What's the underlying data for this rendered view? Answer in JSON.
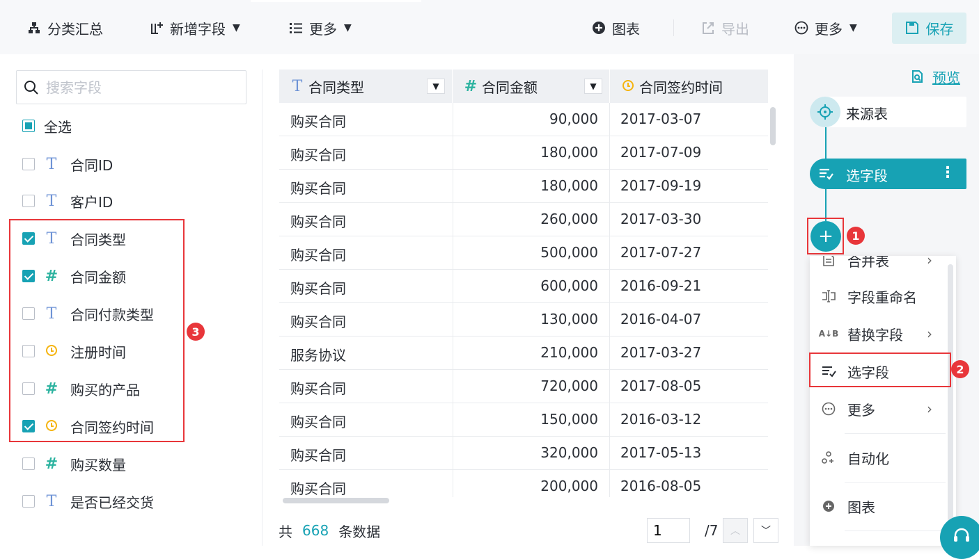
{
  "toolbar": {
    "group_summary": "分类汇总",
    "add_field": "新增字段",
    "more_left": "更多",
    "chart": "图表",
    "export": "导出",
    "more_right": "更多",
    "save": "保存"
  },
  "fields": {
    "search_placeholder": "搜索字段",
    "select_all": "全选",
    "items": [
      {
        "label": "合同ID",
        "type": "text",
        "checked": false
      },
      {
        "label": "客户ID",
        "type": "text",
        "checked": false
      },
      {
        "label": "合同类型",
        "type": "text",
        "checked": true
      },
      {
        "label": "合同金额",
        "type": "number",
        "checked": true
      },
      {
        "label": "合同付款类型",
        "type": "text",
        "checked": false
      },
      {
        "label": "注册时间",
        "type": "date",
        "checked": false
      },
      {
        "label": "购买的产品",
        "type": "number",
        "checked": false
      },
      {
        "label": "合同签约时间",
        "type": "date",
        "checked": true
      },
      {
        "label": "购买数量",
        "type": "number",
        "checked": false
      },
      {
        "label": "是否已经交货",
        "type": "text",
        "checked": false
      }
    ]
  },
  "table": {
    "columns": [
      {
        "label": "合同类型",
        "type": "text"
      },
      {
        "label": "合同金额",
        "type": "number"
      },
      {
        "label": "合同签约时间",
        "type": "date"
      }
    ],
    "rows": [
      [
        "购买合同",
        "90,000",
        "2017-03-07"
      ],
      [
        "购买合同",
        "180,000",
        "2017-07-09"
      ],
      [
        "购买合同",
        "180,000",
        "2017-09-19"
      ],
      [
        "购买合同",
        "260,000",
        "2017-03-30"
      ],
      [
        "购买合同",
        "500,000",
        "2017-07-27"
      ],
      [
        "购买合同",
        "600,000",
        "2016-09-21"
      ],
      [
        "购买合同",
        "130,000",
        "2016-04-07"
      ],
      [
        "服务协议",
        "210,000",
        "2017-03-27"
      ],
      [
        "购买合同",
        "720,000",
        "2017-08-05"
      ],
      [
        "购买合同",
        "150,000",
        "2016-03-12"
      ],
      [
        "购买合同",
        "320,000",
        "2017-05-13"
      ],
      [
        "购买合同",
        "200,000",
        "2016-08-05"
      ]
    ]
  },
  "footer": {
    "prefix": "共",
    "count": "668",
    "suffix": "条数据",
    "page": "1",
    "total_pages": "/7"
  },
  "flow": {
    "preview": "预览",
    "source_node": "来源表",
    "select_node": "选字段",
    "menu": {
      "merge": "合并表",
      "rename": "字段重命名",
      "replace": "替换字段",
      "select": "选字段",
      "more": "更多",
      "automation": "自动化",
      "chart": "图表"
    }
  },
  "annotations": [
    "1",
    "2",
    "3"
  ],
  "colors": {
    "accent": "#17a2b4",
    "highlight": "#e8363a",
    "number_icon": "#2db3a0",
    "date_icon": "#f5b40f",
    "text_icon": "#6e93d6"
  }
}
